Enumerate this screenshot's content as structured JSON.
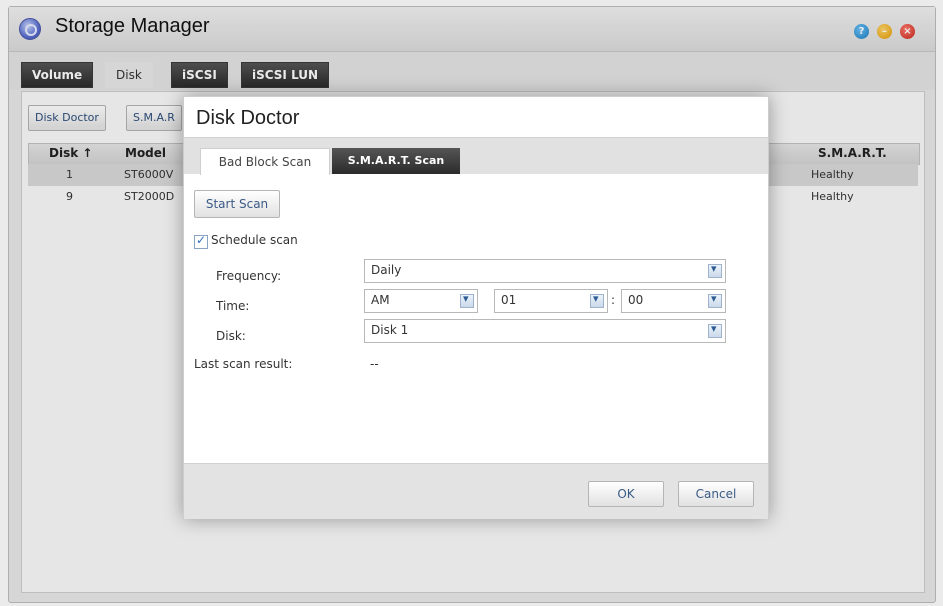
{
  "window": {
    "title": "Storage Manager",
    "tabs": [
      "Volume",
      "Disk",
      "iSCSI",
      "iSCSI LUN"
    ],
    "active_tab": "Disk"
  },
  "toolbar": {
    "disk_doctor": "Disk Doctor",
    "smart": "S.M.A.R"
  },
  "grid": {
    "columns": [
      "Disk ↑",
      "Model",
      "S.M.A.R.T."
    ],
    "rows": [
      {
        "disk": "1",
        "model": "ST6000V",
        "smart": "Healthy",
        "selected": true
      },
      {
        "disk": "9",
        "model": "ST2000D",
        "smart": "Healthy",
        "selected": false
      }
    ]
  },
  "dialog": {
    "title": "Disk Doctor",
    "tabs": [
      "Bad Block Scan",
      "S.M.A.R.T. Scan"
    ],
    "active_tab": "Bad Block Scan",
    "start_scan": "Start Scan",
    "schedule_scan": {
      "label": "Schedule scan",
      "checked": true
    },
    "frequency": {
      "label": "Frequency:",
      "value": "Daily"
    },
    "time": {
      "label": "Time:",
      "ampm": "AM",
      "hour": "01",
      "separator": ":",
      "minute": "00"
    },
    "disk": {
      "label": "Disk:",
      "value": "Disk 1"
    },
    "last_scan": {
      "label": "Last scan result:",
      "value": "--"
    },
    "ok": "OK",
    "cancel": "Cancel"
  },
  "colors": {
    "dark_tab": "#333333",
    "accent_text": "#3a5a86"
  }
}
